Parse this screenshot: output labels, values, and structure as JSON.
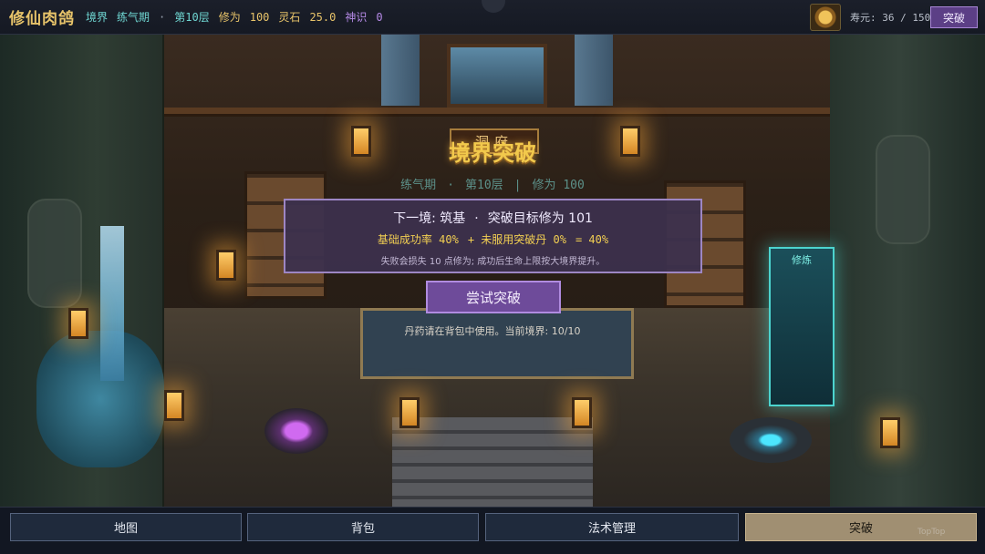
{
  "topbar": {
    "game_title": "修仙肉鸽",
    "realm_label": "境界",
    "realm_value": "练气期",
    "dot": "·",
    "layer": "第10层",
    "cultivation_label": "修为",
    "cultivation_value": "100",
    "spirit_stone_label": "灵石",
    "spirit_stone_value": "25.0",
    "divine_sense_label": "神识",
    "divine_sense_value": "0",
    "lifespan": "寿元: 36 / 150",
    "breakthrough_button": "突破"
  },
  "scene": {
    "sign": "洞府",
    "scroll_panel_title": "修炼"
  },
  "breakthrough": {
    "title": "境界突破",
    "current_realm": "练气期",
    "current_layer": "第10层",
    "divider": "|",
    "current_cultivation": "修为 100",
    "next_realm_line": "下一境: 筑基",
    "target_line": "突破目标修为 101",
    "dot": "·",
    "base_rate": "基础成功率 40%",
    "pill_bonus": "+ 未服用突破丹 0%",
    "total_rate": "= 40%",
    "failure_note": "失败会损失 10 点修为; 成功后生命上限按大境界提升。",
    "try_button": "尝试突破",
    "hint": "丹药请在背包中使用。当前境界: 10/10"
  },
  "bottom_nav": {
    "items": [
      {
        "label": "地图",
        "active": false
      },
      {
        "label": "背包",
        "active": false
      },
      {
        "label": "法术管理",
        "active": false
      },
      {
        "label": "突破",
        "active": true
      }
    ],
    "watermark": "TopTop"
  },
  "colors": {
    "gold": "#e8c46a",
    "cyan": "#6fd6d2",
    "purple_accent": "#6e4b9a",
    "active_tab": "#a08f72"
  }
}
